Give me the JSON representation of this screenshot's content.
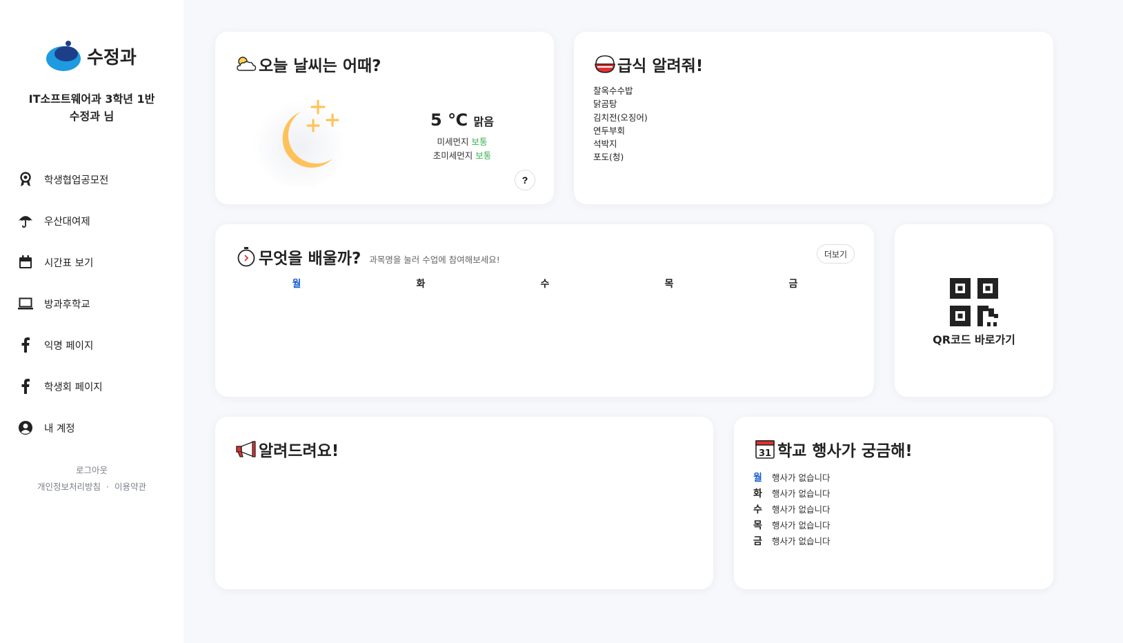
{
  "sidebar": {
    "logo_text": "수정과",
    "user_line1": "IT소프트웨어과 3학년 1반",
    "user_line2": "수정과 님",
    "items": [
      {
        "label": "학생협업공모전",
        "icon": "award-icon"
      },
      {
        "label": "우산대여제",
        "icon": "umbrella-icon"
      },
      {
        "label": "시간표 보기",
        "icon": "calendar-icon"
      },
      {
        "label": "방과후학교",
        "icon": "laptop-icon"
      },
      {
        "label": "익명 페이지",
        "icon": "facebook-icon"
      },
      {
        "label": "학생회 페이지",
        "icon": "facebook-icon"
      },
      {
        "label": "내 계정",
        "icon": "user-circle-icon"
      }
    ],
    "logout": "로그아웃",
    "privacy": "개인정보처리방침",
    "separator": "·",
    "terms": "이용약관"
  },
  "weather": {
    "title": "오늘 날씨는 어때?",
    "temp": "5 ℃",
    "condition": "맑음",
    "dust_label": "미세먼지",
    "dust_value": "보통",
    "fine_dust_label": "초미세먼지",
    "fine_dust_value": "보통",
    "help": "?"
  },
  "meal": {
    "title": "급식 알려줘!",
    "items": [
      "찰옥수수밥",
      "닭곰탕",
      "김치전(오징어)",
      "연두부회",
      "석박지",
      "포도(청)"
    ]
  },
  "classes": {
    "title": "무엇을 배울까?",
    "hint": "과목명을 눌러 수업에 참여해보세요!",
    "more": "더보기",
    "days": [
      "월",
      "화",
      "수",
      "목",
      "금"
    ]
  },
  "qr": {
    "label": "QR코드 바로가기"
  },
  "notice": {
    "title": "알려드려요!"
  },
  "events": {
    "title": "학교 행사가 궁금해!",
    "rows": [
      {
        "day": "월",
        "text": "행사가 없습니다"
      },
      {
        "day": "화",
        "text": "행사가 없습니다"
      },
      {
        "day": "수",
        "text": "행사가 없습니다"
      },
      {
        "day": "목",
        "text": "행사가 없습니다"
      },
      {
        "day": "금",
        "text": "행사가 없습니다"
      }
    ],
    "calendar_icon_number": "31"
  },
  "colors": {
    "accent_blue": "#1a5fd0",
    "dust_green": "#37b24d",
    "moon_yellow": "#ffc25a"
  }
}
